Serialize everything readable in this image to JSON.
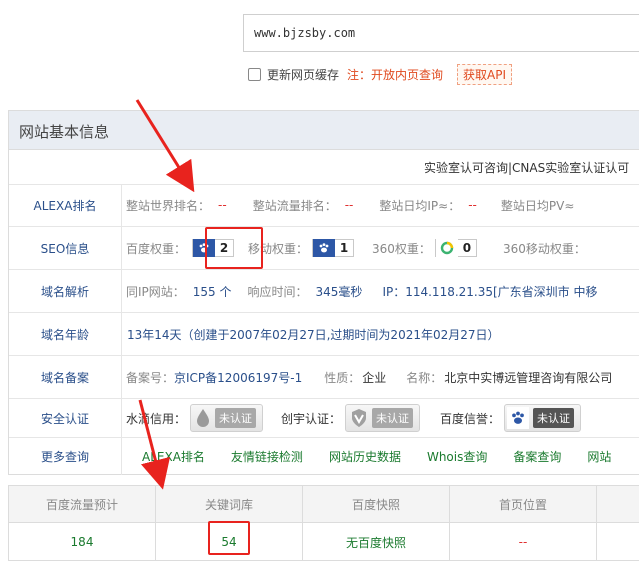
{
  "search": {
    "value": "www.bjzsby.com"
  },
  "options": {
    "cache_label": "更新网页缓存",
    "note": "注：开放内页查询",
    "api_button": "获取API"
  },
  "panel": {
    "title": "网站基本信息",
    "lab_text": "实验室认可咨询|CNAS实验室认证认可"
  },
  "alexa": {
    "label": "ALEXA排名",
    "world_rank_key": "整站世界排名：",
    "world_rank_value": "--",
    "traffic_rank_key": "整站流量排名：",
    "traffic_rank_value": "--",
    "daily_ip_key": "整站日均IP≈：",
    "daily_ip_value": "--",
    "daily_pv_key": "整站日均PV≈"
  },
  "seo": {
    "label": "SEO信息",
    "baidu_weight_key": "百度权重：",
    "baidu_weight_value": "2",
    "mobile_weight_key": "移动权重：",
    "mobile_weight_value": "1",
    "w360_key": "360权重：",
    "w360_value": "0",
    "w360_mobile_key": "360移动权重："
  },
  "dns": {
    "label": "域名解析",
    "same_ip_key": "同IP网站：",
    "same_ip_value": "155 个",
    "response_key": "响应时间：",
    "response_value": "345毫秒",
    "ip_text": "IP：114.118.21.35[广东省深圳市 中移"
  },
  "age": {
    "label": "域名年龄",
    "text": "13年14天（创建于2007年02月27日,过期时间为2021年02月27日）"
  },
  "record": {
    "label": "域名备案",
    "num_key": "备案号：",
    "num_value": "京ICP备12006197号-1",
    "nature_key": "性质：",
    "nature_value": "企业",
    "name_key": "名称：",
    "name_value": "北京中实博远管理咨询有限公司"
  },
  "security": {
    "label": "安全认证",
    "shuidi_key": "水滴信用：",
    "shuidi_badge": "未认证",
    "chuangyu_key": "创宇认证：",
    "chuangyu_badge": "未认证",
    "baidu_key": "百度信誉：",
    "baidu_badge": "未认证"
  },
  "more": {
    "label": "更多查询",
    "links": [
      "ALEXA排名",
      "友情链接检测",
      "网站历史数据",
      "Whois查询",
      "备案查询",
      "网站"
    ]
  },
  "stats": {
    "headers": [
      "百度流量预计",
      "关键词库",
      "百度快照",
      "首页位置"
    ],
    "values": [
      "184",
      "54",
      "无百度快照",
      "--"
    ]
  }
}
